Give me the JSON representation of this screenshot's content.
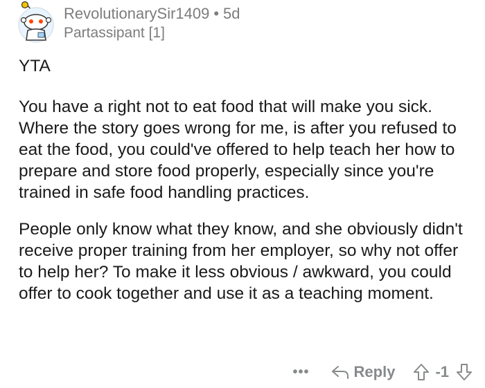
{
  "comment": {
    "author": "RevolutionarySir1409",
    "separator": "•",
    "age": "5d",
    "flair": "Partassipant [1]",
    "paragraphs": [
      "YTA",
      "You have a right not to eat food that will make you sick. Where the story goes wrong for me, is after you refused to eat the food, you could've offered to help teach her how to prepare and store food properly, especially since you're trained in safe food handling practices.",
      "People only know what they know, and she obviously didn't receive proper training from her employer, so why not offer to help her? To make it less obvious / awkward, you could offer to cook together and use it as a teaching moment."
    ]
  },
  "actions": {
    "more_label": "•••",
    "reply_label": "Reply",
    "score": "-1"
  },
  "icons": {
    "avatar": "snoo-avatar-icon",
    "reply": "reply-arrow-icon",
    "upvote": "upvote-arrow-icon",
    "downvote": "downvote-arrow-icon",
    "more": "more-options-icon"
  },
  "colors": {
    "text": "#1a1a1b",
    "meta": "#7c7c7c",
    "action": "#878a8c",
    "avatar_ring": "#9ed3ff",
    "avatar_antenna": "#f5c400"
  }
}
